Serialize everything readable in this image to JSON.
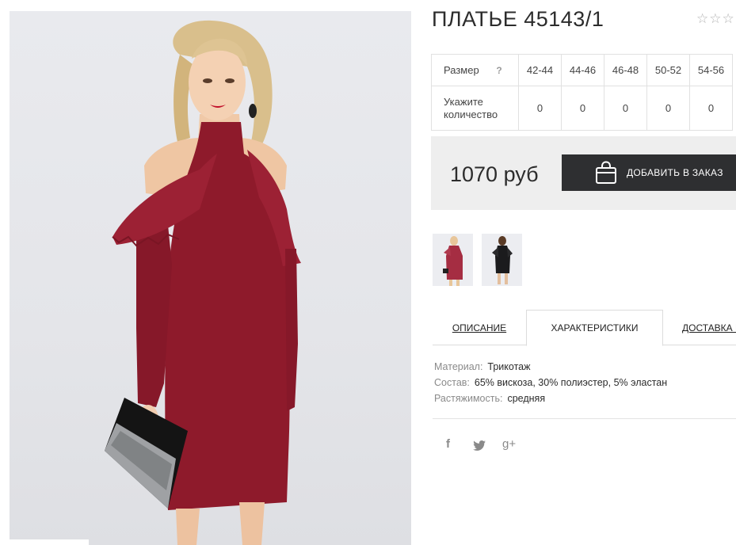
{
  "product": {
    "title": "ПЛАТЬЕ 45143/1",
    "rating_stars": "☆☆☆"
  },
  "size_table": {
    "size_label": "Размер",
    "help_icon": "?",
    "qty_label": "Укажите количество",
    "sizes": [
      "42-44",
      "44-46",
      "46-48",
      "50-52",
      "54-56"
    ],
    "quantities": [
      "0",
      "0",
      "0",
      "0",
      "0"
    ]
  },
  "purchase": {
    "price": "1070 руб",
    "button_label": "ДОБАВИТЬ В ЗАКАЗ",
    "button_icon": "shopping-bag-icon"
  },
  "gallery": {
    "thumbnails": [
      "red-dress-photo",
      "black-dress-photo"
    ]
  },
  "tabs": [
    {
      "label": "ОПИСАНИЕ",
      "active": false
    },
    {
      "label": "ХАРАКТЕРИСТИКИ",
      "active": true
    },
    {
      "label": "ДОСТАВКА И",
      "active": false
    }
  ],
  "specs": [
    {
      "key": "Материал:",
      "value": "Трикотаж"
    },
    {
      "key": "Состав:",
      "value": "65% вискоза, 30% полиэстер, 5% эластан"
    },
    {
      "key": "Растяжимость:",
      "value": "средняя"
    }
  ],
  "social": {
    "facebook": "f",
    "twitter": "🐦",
    "google_plus": "g+"
  },
  "colors": {
    "dress": "#8e1a2b",
    "button_bg": "#2e2f31",
    "price_box_bg": "#eeeeee"
  }
}
